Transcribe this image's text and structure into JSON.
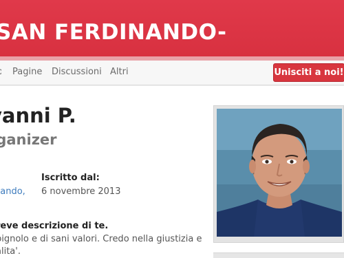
{
  "header": {
    "title": "SAN FERDINANDO-"
  },
  "nav": {
    "items": [
      "Pagine",
      "Discussioni",
      "Altri"
    ],
    "join_label": "Unisciti a noi!"
  },
  "profile": {
    "name": "vanni P.",
    "role": "rganizer",
    "location": "nando,",
    "joined_label": "Iscritto dal:",
    "joined_date": "6 novembre 2013",
    "description_title": "reve descrizione di te.",
    "description_lines": [
      "pignolo e di sani valori. Credo nella giustizia e",
      "alita'."
    ]
  },
  "colors": {
    "banner": "#d83140",
    "accent_button": "#d8363f",
    "link": "#3d7bbd"
  }
}
